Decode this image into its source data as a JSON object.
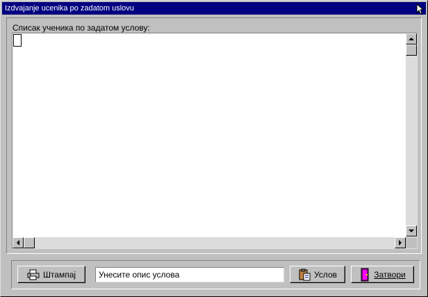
{
  "window": {
    "title": "Izdvajanje ucenika po zadatom uslovu"
  },
  "list": {
    "label": "Списак ученика по задатом услову:"
  },
  "toolbar": {
    "print_label": "Штампај",
    "description_value": "Унесите опис услова",
    "condition_label": "Услов",
    "close_label": "Затвори"
  },
  "icons": {
    "print": "printer-icon",
    "condition": "clipboard-icon",
    "close": "door-icon",
    "cursor": "mouse-pointer-icon"
  },
  "colors": {
    "titlebar": "#000080",
    "face": "#c0c0c0"
  }
}
